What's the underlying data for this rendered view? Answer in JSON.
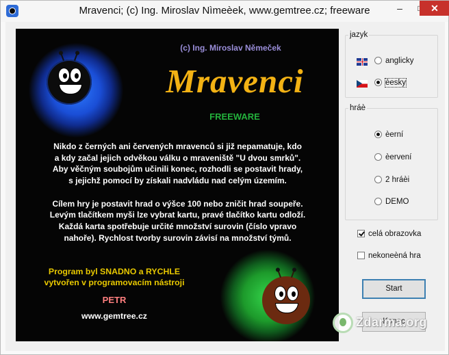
{
  "window": {
    "title": "Mravenci;   (c) Ing. Miroslav Nìmeèek, www.gemtree.cz;   freeware",
    "minimize": "–",
    "maximize": "□",
    "close": "✕"
  },
  "splash": {
    "author": "(c) Ing. Miroslav Němeček",
    "logo": "Mravenci",
    "freeware": "FREEWARE",
    "paragraph1": [
      "Nikdo z černých ani červených mravenců si již nepamatuje, kdo",
      "a kdy začal jejich odvěkou válku o mraveniště \"U dvou smrků\".",
      "Aby věčným soubojům učinili konec, rozhodli se postavit hrady,",
      "s jejichž pomocí by získali nadvládu nad celým územím."
    ],
    "paragraph2": [
      "Cílem hry je postavit hrad o výšce 100 nebo zničit hrad soupeře.",
      "Levým tlačítkem myši lze vybrat kartu, pravé tlačítko kartu odloží.",
      "Každá karta spotřebuje určité množství surovin (číslo vpravo",
      "nahoře). Rychlost tvorby surovin závisí na množství týmů."
    ],
    "program_line1": "Program byl SNADNO a RYCHLE",
    "program_line2": "vytvořen v programovacím nástroji",
    "petr": "PETR",
    "website": "www.gemtree.cz"
  },
  "language": {
    "legend": "jazyk",
    "options": [
      {
        "label": "anglicky",
        "selected": false,
        "flag": "flag-uk-icon"
      },
      {
        "label": "èesky",
        "selected": true,
        "flag": "flag-cz-icon"
      }
    ]
  },
  "players": {
    "legend": "hráè",
    "options": [
      {
        "label": "èerní",
        "selected": true
      },
      {
        "label": "èervení",
        "selected": false
      },
      {
        "label": "2 hráèi",
        "selected": false
      },
      {
        "label": "DEMO",
        "selected": false
      }
    ]
  },
  "checkboxes": {
    "fullscreen": {
      "label": "celá obrazovka",
      "checked": true
    },
    "endless": {
      "label": "nekoneèná hra",
      "checked": false
    }
  },
  "buttons": {
    "start": "Start",
    "quit": "Konec"
  },
  "watermark": "Zdarma.org",
  "colors": {
    "logo": "#f3b214",
    "freeware": "#23b23c",
    "author": "#9a8ed9",
    "program": "#e8c800",
    "petr": "#ff7f7f"
  }
}
